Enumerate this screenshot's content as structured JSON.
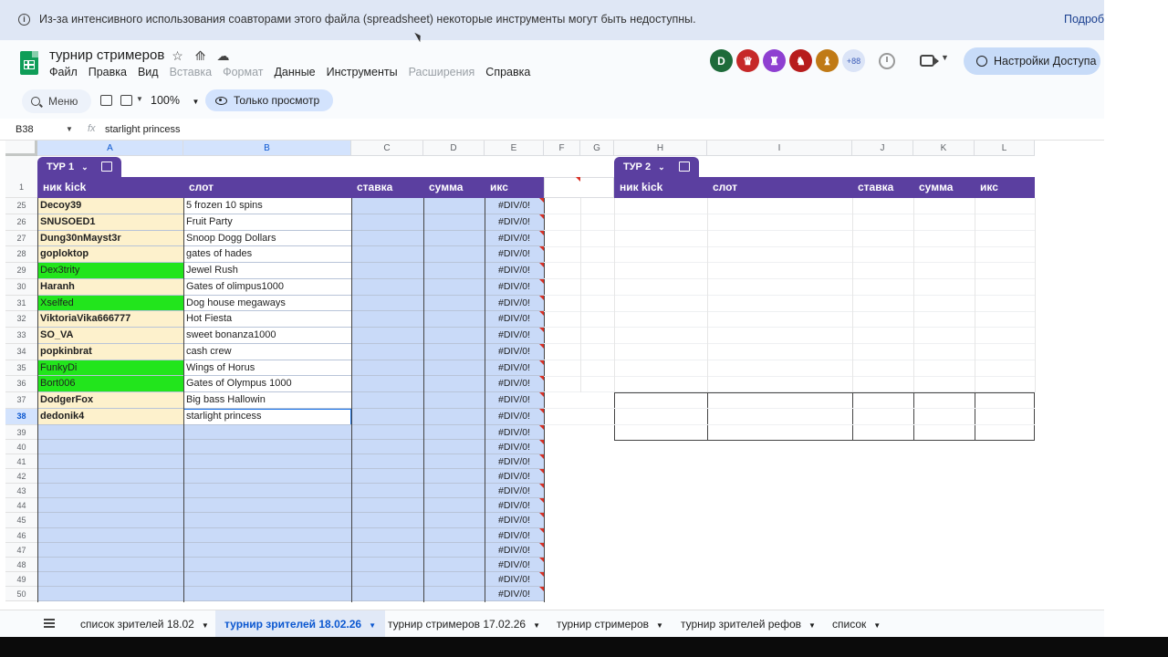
{
  "banner": {
    "message": "Из-за интенсивного использования соавторами этого файла (spreadsheet) некоторые инструменты могут быть недоступны.",
    "more_link": "Подробнее"
  },
  "doc": {
    "title": "турнир стримеров"
  },
  "menu": [
    {
      "label": "Файл",
      "disabled": false
    },
    {
      "label": "Правка",
      "disabled": false
    },
    {
      "label": "Вид",
      "disabled": false
    },
    {
      "label": "Вставка",
      "disabled": true
    },
    {
      "label": "Формат",
      "disabled": true
    },
    {
      "label": "Данные",
      "disabled": false
    },
    {
      "label": "Инструменты",
      "disabled": false
    },
    {
      "label": "Расширения",
      "disabled": true
    },
    {
      "label": "Справка",
      "disabled": false
    }
  ],
  "collaborators": {
    "avatars": [
      {
        "label": "D",
        "color": "#1e6b3a"
      },
      {
        "label": "♛",
        "color": "#c62828"
      },
      {
        "label": "♜",
        "color": "#8e3fd1"
      },
      {
        "label": "♞",
        "color": "#b71c1c"
      },
      {
        "label": "♝",
        "color": "#c07a16"
      }
    ],
    "more_count": "+88"
  },
  "share_button": {
    "label": "Настройки Доступа"
  },
  "toolbar": {
    "search_label": "Меню",
    "zoom": "100%",
    "view_only_label": "Только просмотр"
  },
  "formula_bar": {
    "cell_ref": "B38",
    "fx": "fx",
    "value": "starlight princess"
  },
  "columns": [
    "A",
    "B",
    "C",
    "D",
    "E",
    "F",
    "G",
    "H",
    "I",
    "J",
    "K",
    "L"
  ],
  "table1": {
    "name": "ТУР 1",
    "headers": [
      "ник kick",
      "слот",
      "ставка",
      "сумма",
      "икс"
    ]
  },
  "table2": {
    "name": "ТУР 2",
    "headers": [
      "ник kick",
      "слот",
      "ставка",
      "сумма",
      "икс"
    ]
  },
  "header_row_number": "1",
  "rows": [
    {
      "num": "25",
      "nick": "Decoy39",
      "slot": "5 frozen 10 spins",
      "x": "#DIV/0!",
      "hl": false
    },
    {
      "num": "26",
      "nick": "SNUSOED1",
      "slot": "Fruit Party",
      "x": "#DIV/0!",
      "hl": false
    },
    {
      "num": "27",
      "nick": "Dung30nMayst3r",
      "slot": " Snoop Dogg Dollars",
      "x": "#DIV/0!",
      "hl": false
    },
    {
      "num": "28",
      "nick": "goploktop",
      "slot": "gates of hades",
      "x": "#DIV/0!",
      "hl": false
    },
    {
      "num": "29",
      "nick": "Dex3trity",
      "slot": "Jewel Rush",
      "x": "#DIV/0!",
      "hl": true
    },
    {
      "num": "30",
      "nick": "Haranh",
      "slot": "Gates of olimpus1000",
      "x": "#DIV/0!",
      "hl": false
    },
    {
      "num": "31",
      "nick": "Xselfed",
      "slot": "Dog house megaways",
      "x": "#DIV/0!",
      "hl": true
    },
    {
      "num": "32",
      "nick": "ViktoriaVika666777",
      "slot": "Hot Fiesta",
      "x": "#DIV/0!",
      "hl": false
    },
    {
      "num": "33",
      "nick": "SO_VA",
      "slot": "sweet bonanza1000",
      "x": "#DIV/0!",
      "hl": false
    },
    {
      "num": "34",
      "nick": "popkinbrat",
      "slot": "cash  crew",
      "x": "#DIV/0!",
      "hl": false
    },
    {
      "num": "35",
      "nick": "FunkyDi",
      "slot": "Wings of Horus",
      "x": "#DIV/0!",
      "hl": true
    },
    {
      "num": "36",
      "nick": "Bort006",
      "slot": "Gates of Olympus 1000",
      "x": "#DIV/0!",
      "hl": true
    },
    {
      "num": "37",
      "nick": "DodgerFox",
      "slot": "Big bass Hallowin",
      "x": "#DIV/0!",
      "hl": false
    },
    {
      "num": "38",
      "nick": "dedonik4",
      "slot": "starlight princess",
      "x": "#DIV/0!",
      "hl": false
    },
    {
      "num": "39",
      "nick": "",
      "slot": "",
      "x": "#DIV/0!",
      "hl": false
    },
    {
      "num": "40",
      "nick": "",
      "slot": "",
      "x": "#DIV/0!",
      "hl": false
    },
    {
      "num": "41",
      "nick": "",
      "slot": "",
      "x": "#DIV/0!",
      "hl": false
    },
    {
      "num": "42",
      "nick": "",
      "slot": "",
      "x": "#DIV/0!",
      "hl": false
    },
    {
      "num": "43",
      "nick": "",
      "slot": "",
      "x": "#DIV/0!",
      "hl": false
    },
    {
      "num": "44",
      "nick": "",
      "slot": "",
      "x": "#DIV/0!",
      "hl": false
    },
    {
      "num": "45",
      "nick": "",
      "slot": "",
      "x": "#DIV/0!",
      "hl": false
    },
    {
      "num": "46",
      "nick": "",
      "slot": "",
      "x": "#DIV/0!",
      "hl": false
    },
    {
      "num": "47",
      "nick": "",
      "slot": "",
      "x": "#DIV/0!",
      "hl": false
    },
    {
      "num": "48",
      "nick": "",
      "slot": "",
      "x": "#DIV/0!",
      "hl": false
    },
    {
      "num": "49",
      "nick": "",
      "slot": "",
      "x": "#DIV/0!",
      "hl": false
    },
    {
      "num": "50",
      "nick": "",
      "slot": "",
      "x": "#DIV/0!",
      "hl": false
    }
  ],
  "selected": {
    "row": "38",
    "cols": [
      "A",
      "B"
    ]
  },
  "colors": {
    "table_header": "#5b3fa0",
    "nick_bg": "#fdf1cc",
    "highlight": "#22e51c",
    "value_bg": "#c9daf8",
    "slot_bg_filled": "#ffffff"
  },
  "sheets": [
    {
      "label": "список зрителей 18.02",
      "active": false
    },
    {
      "label": "турнир зрителей 18.02.26",
      "active": true
    },
    {
      "label": "турнир стримеров 17.02.26",
      "active": false
    },
    {
      "label": "турнир стримеров",
      "active": false
    },
    {
      "label": "турнир зрителей рефов",
      "active": false
    },
    {
      "label": "список",
      "active": false
    }
  ]
}
